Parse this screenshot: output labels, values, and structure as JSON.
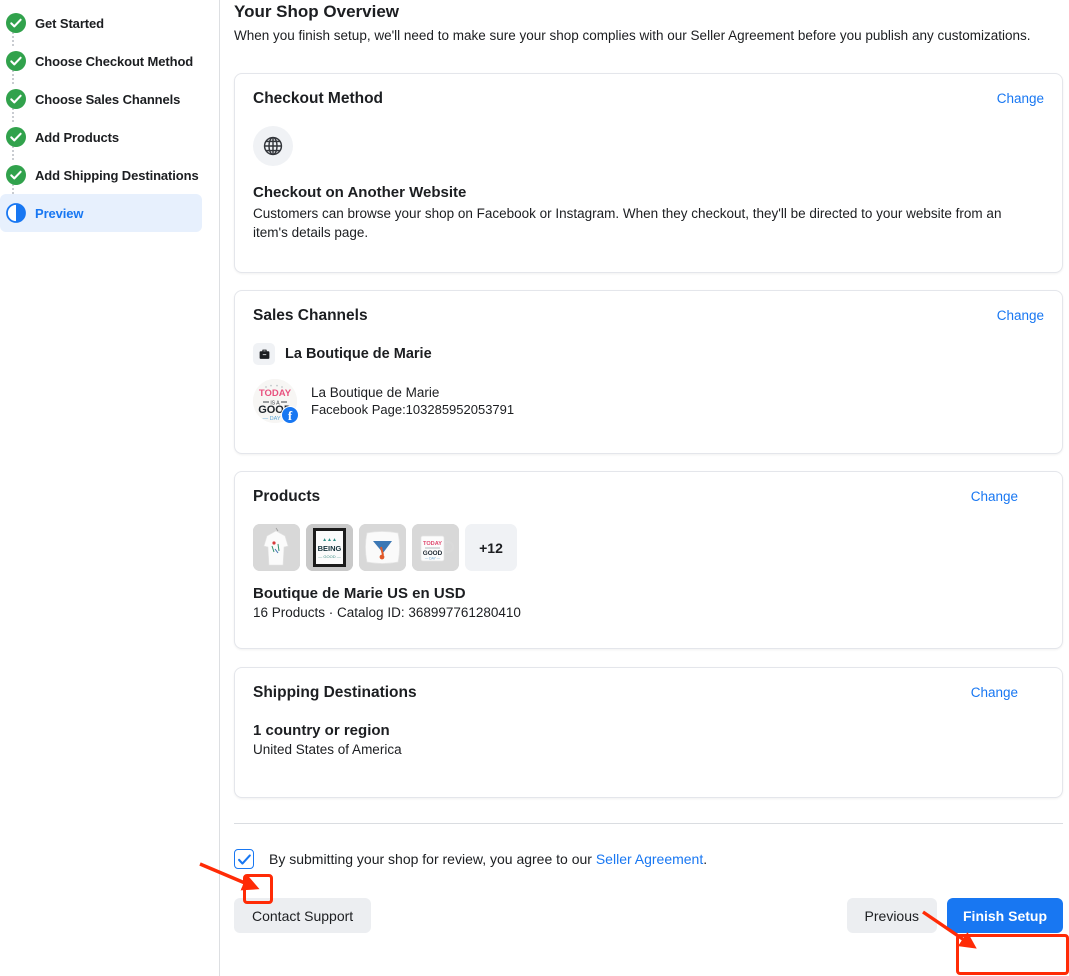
{
  "sidebar": {
    "items": [
      {
        "label": "Get Started",
        "state": "complete",
        "icon": "check-circle-icon"
      },
      {
        "label": "Choose Checkout Method",
        "state": "complete",
        "icon": "check-circle-icon"
      },
      {
        "label": "Choose Sales Channels",
        "state": "complete",
        "icon": "check-circle-icon"
      },
      {
        "label": "Add Products",
        "state": "complete",
        "icon": "check-circle-icon"
      },
      {
        "label": "Add Shipping Destinations",
        "state": "complete",
        "icon": "check-circle-icon"
      },
      {
        "label": "Preview",
        "state": "current",
        "icon": "half-circle-icon"
      }
    ]
  },
  "header": {
    "title": "Your Shop Overview",
    "subtitle": "When you finish setup, we'll need to make sure your shop complies with our Seller Agreement before you publish any customizations."
  },
  "cards": {
    "checkout": {
      "title": "Checkout Method",
      "change_label": "Change",
      "icon": "globe-icon",
      "method_name": "Checkout on Another Website",
      "description": "Customers can browse your shop on Facebook or Instagram. When they checkout, they'll be directed to your website from an item's details page."
    },
    "sales_channels": {
      "title": "Sales Channels",
      "change_label": "Change",
      "channel_icon": "shop-bag-icon",
      "channel_name": "La Boutique de Marie",
      "page": {
        "avatar_icon": "page-avatar",
        "avatar_text_top": "TODAY",
        "avatar_text_mid": "GOOD",
        "avatar_text_bot": "DAY",
        "badge_icon": "facebook-icon",
        "name": "La Boutique de Marie",
        "meta": "Facebook Page:103285952053791"
      }
    },
    "products": {
      "title": "Products",
      "change_label": "Change",
      "thumbs": [
        {
          "name": "long-sleeve-shirt-thumb"
        },
        {
          "name": "framed-poster-thumb"
        },
        {
          "name": "throw-pillow-thumb"
        },
        {
          "name": "mug-thumb"
        }
      ],
      "more_count": "+12",
      "catalog_name": "Boutique de Marie US en USD",
      "catalog_meta": "16 Products · Catalog ID: 368997761280410"
    },
    "shipping": {
      "title": "Shipping Destinations",
      "change_label": "Change",
      "count_label": "1 country or region",
      "countries": "United States of America"
    }
  },
  "agreement": {
    "checked": true,
    "text_before": "By submitting your shop for review, you agree to our ",
    "link_label": "Seller Agreement",
    "text_after": "."
  },
  "footer": {
    "contact_support_label": "Contact Support",
    "previous_label": "Previous",
    "finish_label": "Finish Setup"
  },
  "colors": {
    "accent_blue": "#1877f2",
    "complete_green": "#31a24c",
    "annotation_red": "#ff2b06",
    "active_row_bg": "#e7f0fd"
  }
}
